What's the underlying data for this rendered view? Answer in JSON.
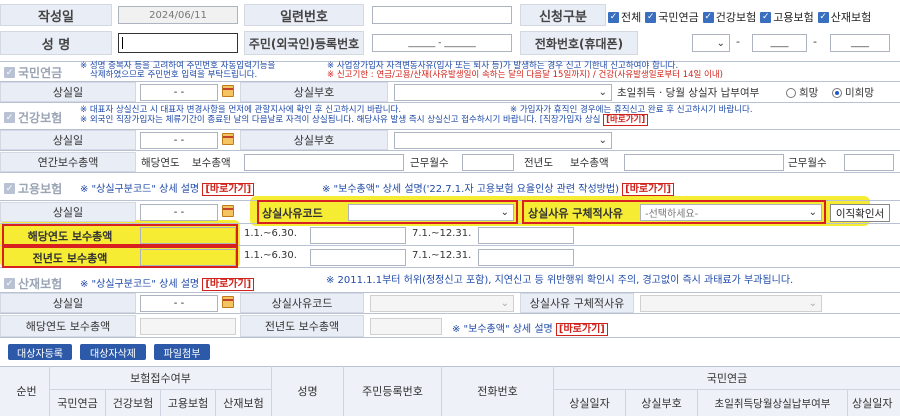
{
  "top": {
    "date_label": "작성일",
    "date_value": "2024/06/11",
    "serial_label": "일련번호",
    "apply_type_label": "신청구분",
    "apply_all": "전체",
    "apply_pension": "국민연금",
    "apply_health": "건강보험",
    "apply_employment": "고용보험",
    "apply_industrial": "산재보험",
    "name_label": "성 명",
    "resident_label": "주민(외국인)등록번호",
    "resident_placeholder": "______ - _______",
    "phone_label": "전화번호(휴대폰)",
    "phone_dash1": "-",
    "phone_dash2": "-",
    "phone_mid": "____",
    "phone_last": "____"
  },
  "pension": {
    "header": "국민연금",
    "note1": "※ 성명 중복자 등을 고려하여 주민번호 자동입력기능을",
    "note1b": "삭제하였으므로 주민번호 입력을 부탁드립니다.",
    "note2": "※ 사업장가입자 자격변동사유(입사 또는 퇴사 등)가 발생하는 경우 신고 기한내 신고하여야 합니다.",
    "note2b": "※ 신고기한 : 연금/고용/산재(사유발생일이 속하는 달의 다음달 15일까지) / 건강(사유발생일로부터 14일 이내)",
    "loss_date_label": "상실일",
    "date_placeholder": "- -",
    "loss_code_label": "상실부호",
    "first_month_label": "초일취득 · 당월 상실자 납부여부",
    "opt_yes": "희망",
    "opt_no": "미희망"
  },
  "health": {
    "header": "건강보험",
    "note1": "※ 대표자 상실신고 시 대표자 변경사항을 먼저에 관할지사에 확인 후 신고하시기 바랍니다.",
    "note1b": "※ 가입자가 휴직인 경우에는 휴직신고 완료 후 신고하시기 바랍니다.",
    "note2": "※ 외국인 직장가입자는 체류기간이 종료된 날의 다음날로 자격이 상실됩니다. 해당사유 발생 즉시 상실신고 접수하시기 바랍니다. [직장가입자 상실",
    "link": "[바로가기]",
    "loss_date_label": "상실일",
    "loss_code_label": "상실부호",
    "annual_label": "연간보수총액",
    "this_year_label": "해당연도",
    "pay_total_label": "보수총액",
    "work_months_label": "근무월수",
    "prev_year_label": "전년도",
    "pay_total_label2": "보수총액",
    "work_months_label2": "근무월수"
  },
  "employment": {
    "header": "고용보험",
    "note1": "※ \"상실구분코드\" 상세 설명",
    "link1": "[바로가기]",
    "note2": "※ \"보수총액\" 상세 설명('22.7.1.자 고용보험 요율인상 관련 작성방법)",
    "link2": "[바로가기]",
    "loss_date_label": "상실일",
    "reason_code_label": "상실사유코드",
    "reason_detail_label": "상실사유 구체적사유",
    "reason_detail_placeholder": "-선택하세요-",
    "confirm_button": "이직확인서",
    "this_year_pay_label": "해당연도 보수총액",
    "prev_year_pay_label": "전년도 보수총액",
    "period1": "1.1.~6.30.",
    "period2": "7.1.~12.31.",
    "period3": "1.1.~6.30.",
    "period4": "7.1.~12.31."
  },
  "industrial": {
    "header": "산재보험",
    "note1": "※ \"상실구분코드\" 상세 설명",
    "link1": "[바로가기]",
    "note2": "※ 2011.1.1부터 허위(정정신고 포함), 지연신고 등 위반행위 확인시 주의, 경고없이 즉시 과태료가 부과됩니다.",
    "loss_date_label": "상실일",
    "reason_code_label": "상실사유코드",
    "reason_detail_label": "상실사유 구체적사유",
    "this_year_pay_label": "해당연도 보수총액",
    "prev_year_pay_label": "전년도 보수총액",
    "note3": "※ \"보수총액\" 상세 설명",
    "link3": "[바로가기]"
  },
  "buttons": {
    "register": "대상자등록",
    "delete": "대상자삭제",
    "attach": "파일첨부"
  },
  "table": {
    "col_no": "순번",
    "col_insurance_group": "보험접수여부",
    "col_pension": "국민연금",
    "col_health": "건강보험",
    "col_employment": "고용보험",
    "col_industrial": "산재보험",
    "col_name": "성명",
    "col_resident": "주민등록번호",
    "col_phone": "전화번호",
    "col_pension_group": "국민연금",
    "col_loss_date": "상실일자",
    "col_loss_code": "상실부호",
    "col_first_month": "초일취득당월상실납부여부",
    "col_loss_date2": "상실일자"
  },
  "colors": {
    "accent": "#2d5aa8",
    "highlight": "#f5ea1e",
    "alert_red": "#d0221a"
  }
}
